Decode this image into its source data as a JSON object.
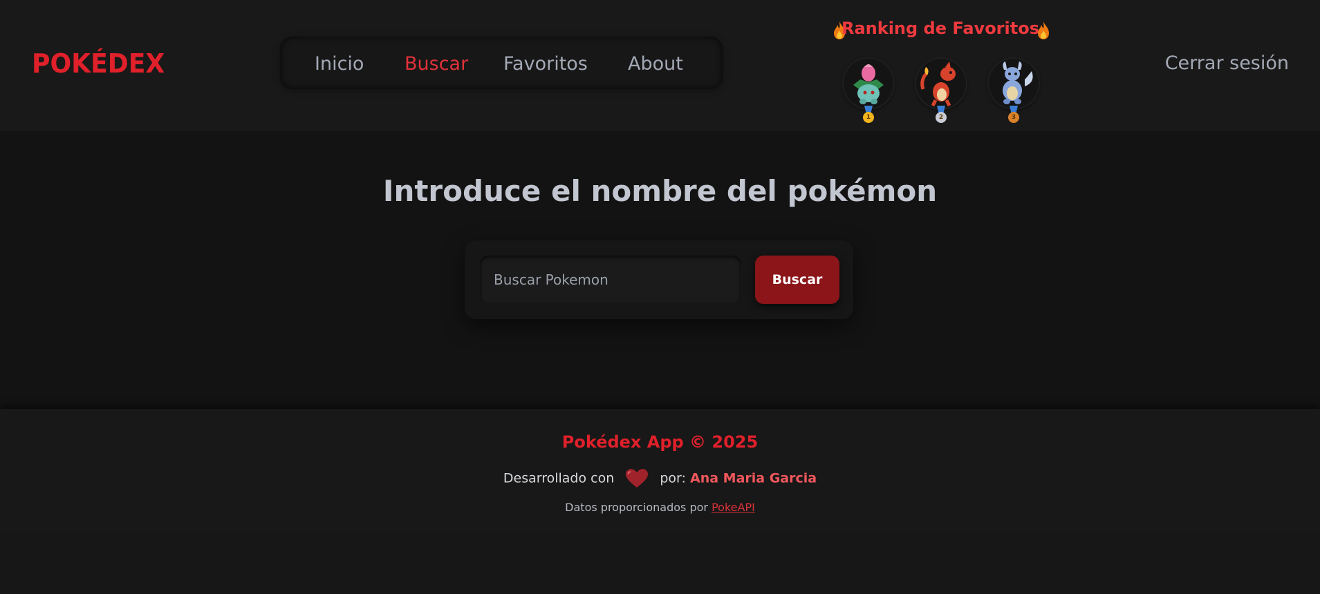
{
  "header": {
    "logo": "POKÉDEX",
    "nav": [
      {
        "label": "Inicio",
        "active": false
      },
      {
        "label": "Buscar",
        "active": true
      },
      {
        "label": "Favoritos",
        "active": false
      },
      {
        "label": "About",
        "active": false
      }
    ],
    "ranking": {
      "title": "Ranking de Favoritos",
      "icon": "flame-icon",
      "entries": [
        {
          "pokemon_icon": "ivysaur-icon",
          "medal": "1",
          "medal_color": "#f2b51c"
        },
        {
          "pokemon_icon": "charmeleon-icon",
          "medal": "2",
          "medal_color": "#c9ccd4"
        },
        {
          "pokemon_icon": "wartortle-icon",
          "medal": "3",
          "medal_color": "#d9822b"
        }
      ]
    },
    "logout_label": "Cerrar sesión"
  },
  "main": {
    "title": "Introduce el nombre del pokémon",
    "search": {
      "placeholder": "Buscar Pokemon",
      "value": "",
      "button_label": "Buscar"
    }
  },
  "footer": {
    "title": "Pokédex App © 2025",
    "credits_prefix": "Desarrollado con",
    "credits_icon": "heart-icon",
    "credits_middle": "por:",
    "author": "Ana Maria Garcia",
    "data_prefix": "Datos proporcionados por",
    "data_link": "PokeAPI"
  },
  "colors": {
    "accent": "#e0202a",
    "button": "#8b1519",
    "background": "#171717",
    "text_muted": "#a3a9b5"
  }
}
